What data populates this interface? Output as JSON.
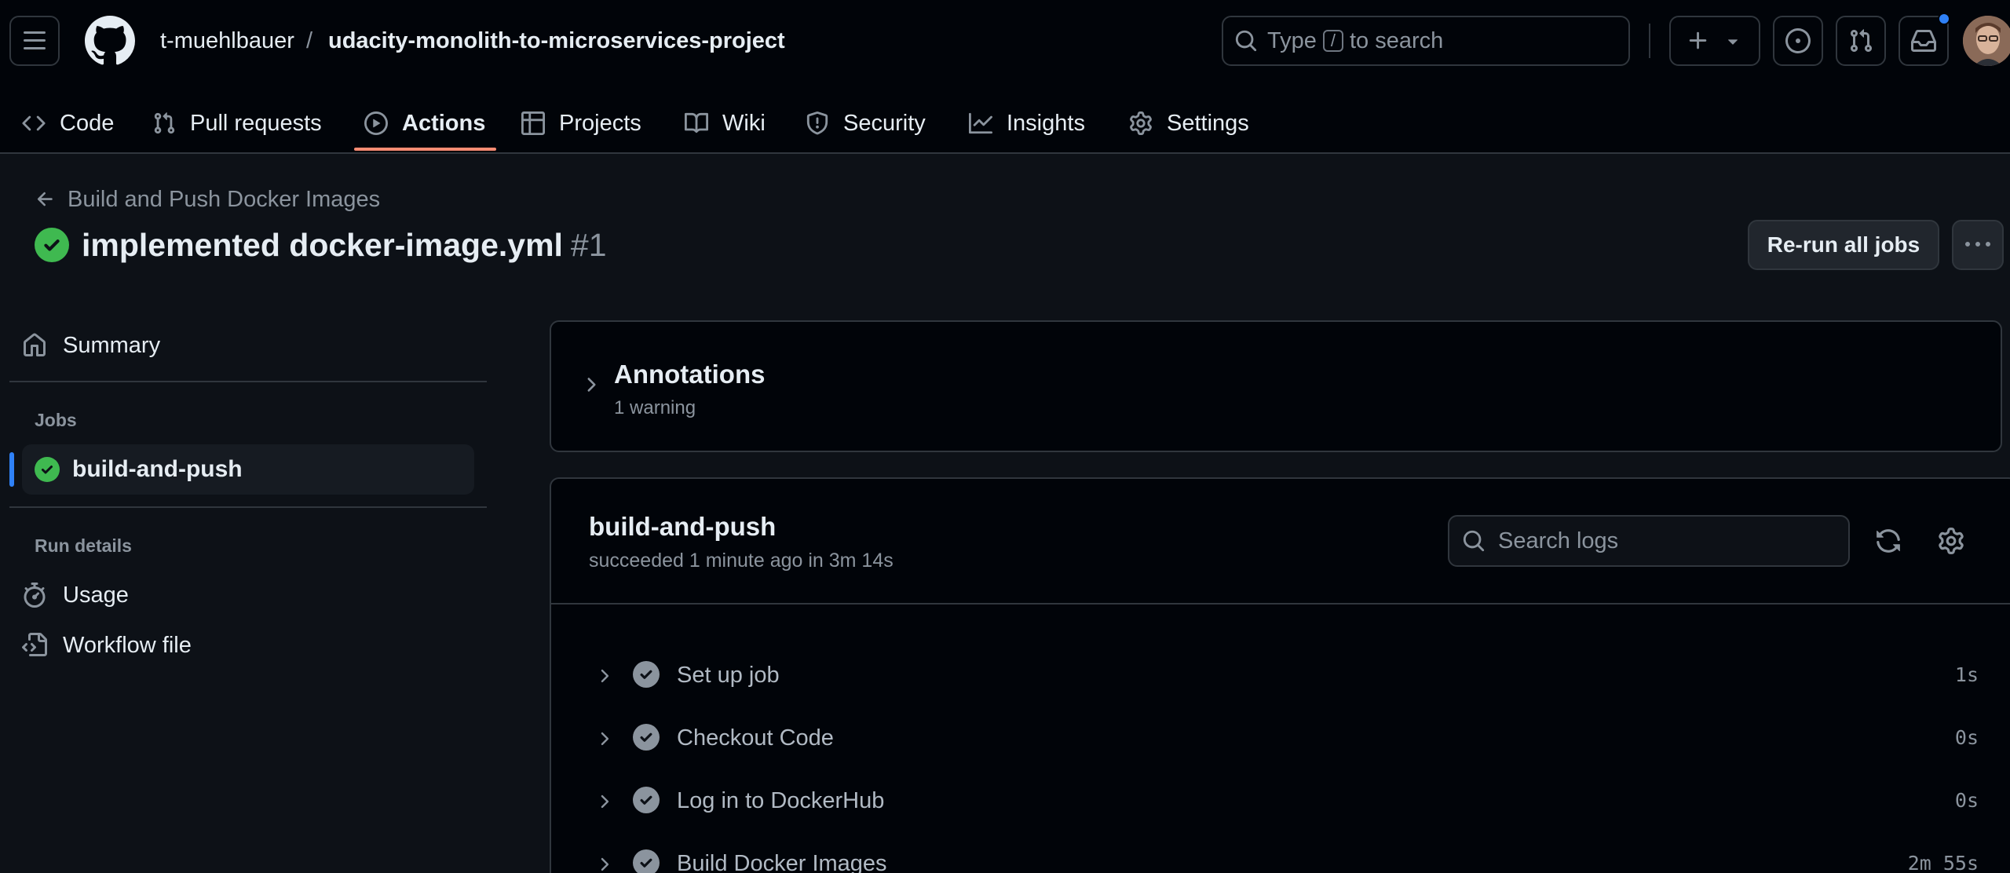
{
  "header": {
    "owner": "t-muehlbauer",
    "separator": "/",
    "repo": "udacity-monolith-to-microservices-project",
    "search_prefix": "Type",
    "search_key": "/",
    "search_suffix": "to search"
  },
  "nav": {
    "tabs": [
      {
        "label": "Code",
        "icon": "code-icon"
      },
      {
        "label": "Pull requests",
        "icon": "git-pull-request-icon"
      },
      {
        "label": "Actions",
        "icon": "play-icon",
        "active": true
      },
      {
        "label": "Projects",
        "icon": "table-icon"
      },
      {
        "label": "Wiki",
        "icon": "book-icon"
      },
      {
        "label": "Security",
        "icon": "shield-icon"
      },
      {
        "label": "Insights",
        "icon": "graph-icon"
      },
      {
        "label": "Settings",
        "icon": "gear-icon"
      }
    ]
  },
  "run": {
    "workflow_name": "Build and Push Docker Images",
    "title": "implemented docker-image.yml",
    "number": "#1",
    "rerun_label": "Re-run all jobs"
  },
  "sidebar": {
    "summary_label": "Summary",
    "jobs_heading": "Jobs",
    "job_label": "build-and-push",
    "run_details_heading": "Run details",
    "usage_label": "Usage",
    "workflow_file_label": "Workflow file"
  },
  "annotations": {
    "title": "Annotations",
    "subtitle": "1 warning"
  },
  "job": {
    "name": "build-and-push",
    "status": "succeeded 1 minute ago in 3m 14s",
    "search_placeholder": "Search logs",
    "steps": [
      {
        "label": "Set up job",
        "duration": "1s"
      },
      {
        "label": "Checkout Code",
        "duration": "0s"
      },
      {
        "label": "Log in to DockerHub",
        "duration": "0s"
      },
      {
        "label": "Build Docker Images",
        "duration": "2m 55s"
      }
    ]
  },
  "colors": {
    "background": "#0d1117",
    "header_bg": "#010409",
    "border": "#30363d",
    "success": "#3fb950",
    "active_underline": "#fd8c73",
    "accent_blue": "#2f81f7"
  }
}
